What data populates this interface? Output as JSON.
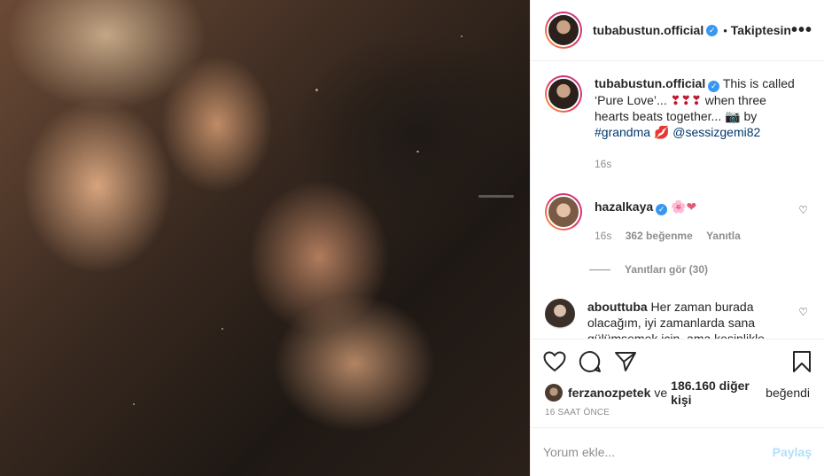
{
  "header": {
    "username": "tubabustun.official",
    "verified_mark": "✓",
    "separator": "•",
    "follow_status": "Takiptesin",
    "more": "•••"
  },
  "caption": {
    "username": "tubabustun.official",
    "text_1": "This is called ‘Pure Love’...",
    "hearts": "❣❣❣",
    "text_2": "when three hearts beats together...",
    "camera": "📷",
    "by": "by",
    "hashtag": "#grandma",
    "lips": "💋",
    "mention": "@sessizgemi82",
    "time": "16s"
  },
  "comments": [
    {
      "username": "hazalkaya",
      "text": "🌸❤",
      "time": "16s",
      "likes": "362 beğenme",
      "reply": "Yanıtla",
      "view_replies": "Yanıtları gör (30)"
    },
    {
      "username": "abouttuba",
      "text": "Her zaman burada olacağım, iyi zamanlarda sana gülümsemek için, ama kesinlikle"
    }
  ],
  "likes": {
    "user": "ferzanozpetek",
    "connector": "ve",
    "count": "186.160 diğer kişi",
    "suffix": "beğendi"
  },
  "timestamp": "16 SAAT ÖNCE",
  "add_comment": {
    "placeholder": "Yorum ekle...",
    "post_label": "Paylaş"
  },
  "icons": [
    "heart-icon",
    "comment-icon",
    "share-icon",
    "bookmark-icon",
    "more-icon",
    "verified-icon"
  ],
  "colors": {
    "link": "#00376b",
    "verified": "#3897f0",
    "muted": "#8e8e8e",
    "post_disabled": "#b2dffc"
  }
}
